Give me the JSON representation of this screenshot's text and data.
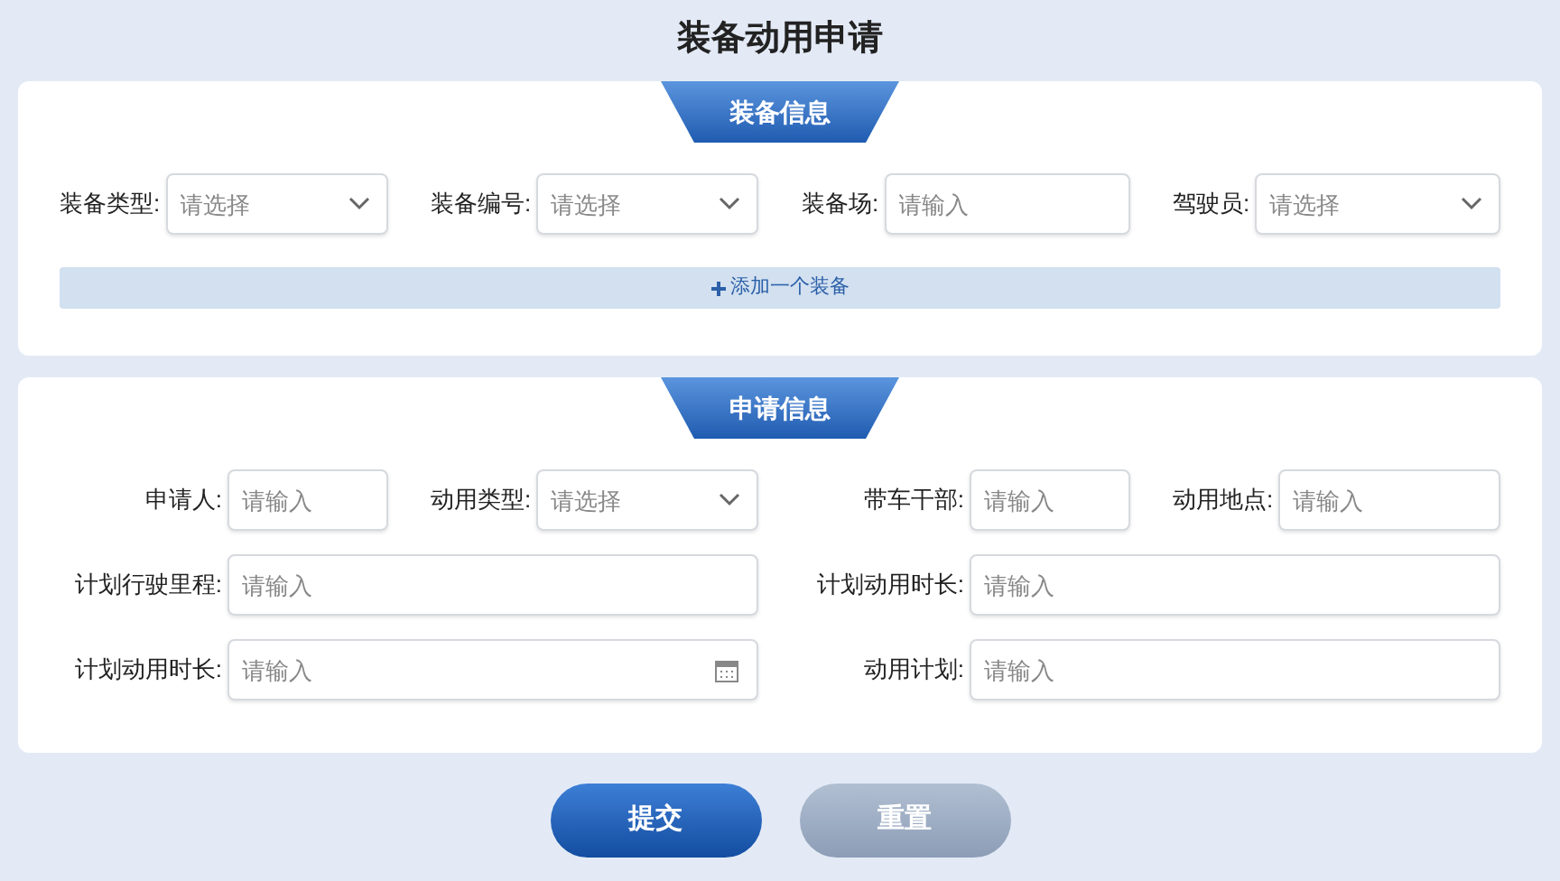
{
  "title": "装备动用申请",
  "sections": [
    {
      "title": "装备信息",
      "rows": [
        [
          {
            "label": "装备类型:",
            "placeholder": "请选择",
            "kind": "select"
          },
          {
            "label": "装备编号:",
            "placeholder": "请选择",
            "kind": "select"
          },
          {
            "label": "装备场:",
            "placeholder": "请输入",
            "kind": "text"
          },
          {
            "label": "驾驶员:",
            "placeholder": "请选择",
            "kind": "select"
          }
        ]
      ],
      "add_button": "添加一个装备"
    },
    {
      "title": "申请信息",
      "rows": [
        [
          {
            "label": "申请人:",
            "placeholder": "请输入",
            "kind": "text"
          },
          {
            "label": "动用类型:",
            "placeholder": "请选择",
            "kind": "select"
          },
          {
            "label": "带车干部:",
            "placeholder": "请输入",
            "kind": "text"
          },
          {
            "label": "动用地点:",
            "placeholder": "请输入",
            "kind": "text"
          }
        ],
        [
          {
            "label": "计划行驶里程:",
            "placeholder": "请输入",
            "kind": "text"
          },
          {
            "label": "计划动用时长:",
            "placeholder": "请输入",
            "kind": "text"
          }
        ],
        [
          {
            "label": "计划动用时长:",
            "placeholder": "请输入",
            "kind": "date"
          },
          {
            "label": "动用计划:",
            "placeholder": "请输入",
            "kind": "text"
          }
        ]
      ]
    }
  ],
  "buttons": [
    {
      "label": "提交",
      "kind": "primary"
    },
    {
      "label": "重置",
      "kind": "secondary"
    }
  ]
}
